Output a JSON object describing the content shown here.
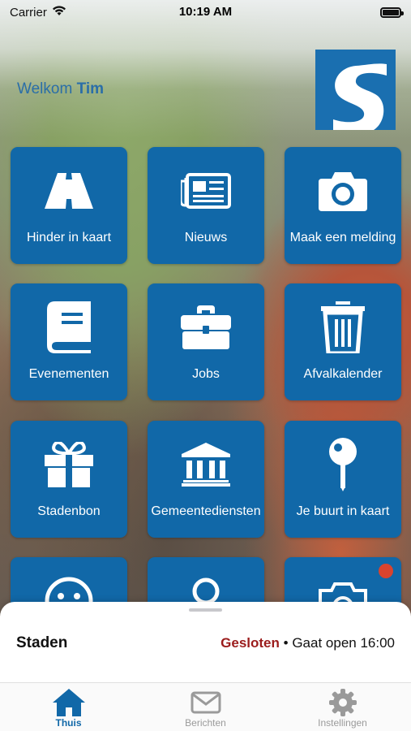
{
  "status": {
    "carrier": "Carrier",
    "time": "10:19 AM"
  },
  "header": {
    "welcome_prefix": "Welkom",
    "user_name": "Tim",
    "logo_letter": "S"
  },
  "tiles": [
    {
      "label": "Hinder in kaart",
      "icon": "road-icon"
    },
    {
      "label": "Nieuws",
      "icon": "newspaper-icon"
    },
    {
      "label": "Maak een melding",
      "icon": "camera-icon"
    },
    {
      "label": "Evenementen",
      "icon": "book-icon"
    },
    {
      "label": "Jobs",
      "icon": "briefcase-icon"
    },
    {
      "label": "Afvalkalender",
      "icon": "trash-icon"
    },
    {
      "label": "Stadenbon",
      "icon": "gift-icon"
    },
    {
      "label": "Gemeentediensten",
      "icon": "building-icon"
    },
    {
      "label": "Je buurt in kaart",
      "icon": "map-pin-icon"
    },
    {
      "label": "",
      "icon": "smiley-icon"
    },
    {
      "label": "",
      "icon": "person-icon"
    },
    {
      "label": "",
      "icon": "photo-camera-icon"
    }
  ],
  "info_sheet": {
    "place": "Staden",
    "status": "Gesloten",
    "separator": "•",
    "opening": "Gaat open 16:00"
  },
  "tabs": [
    {
      "label": "Thuis",
      "icon": "home-icon",
      "active": true
    },
    {
      "label": "Berichten",
      "icon": "mail-icon",
      "active": false
    },
    {
      "label": "Instellingen",
      "icon": "gear-icon",
      "active": false
    }
  ],
  "colors": {
    "tile": "#1168a8",
    "accent": "#1168a8",
    "closed": "#9b1c1c",
    "inactive": "#9a9a9a"
  }
}
